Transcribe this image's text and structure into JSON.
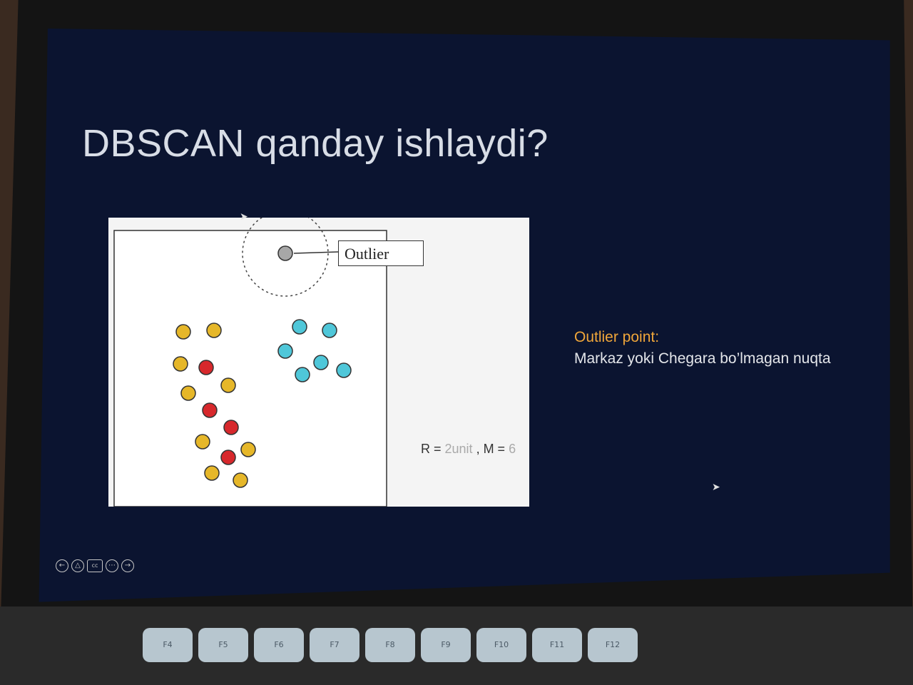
{
  "slide": {
    "title": "DBSCAN qanday ishlaydi?",
    "figure": {
      "outlier_label": "Outlier",
      "radius_prefix": "R = ",
      "radius_value": "2unit",
      "sep": " , M = ",
      "min_points": "6"
    },
    "description": {
      "heading": "Outlier point:",
      "text": "Markaz yoki Chegara bo’lmagan nuqta"
    }
  },
  "colors": {
    "core": "#e6b729",
    "border": "#d7282c",
    "cluster2": "#4fc7d9",
    "outlier": "#a7a7a7",
    "slide_bg": "#0b1430",
    "heading": "#f0a63a"
  },
  "controls": [
    "back-icon",
    "pen-icon",
    "cc-icon",
    "more-icon",
    "forward-icon"
  ],
  "keyboard": {
    "keys": [
      "F4",
      "F5",
      "F6",
      "F7",
      "F8",
      "F9",
      "F10",
      "F11",
      "F12"
    ]
  }
}
